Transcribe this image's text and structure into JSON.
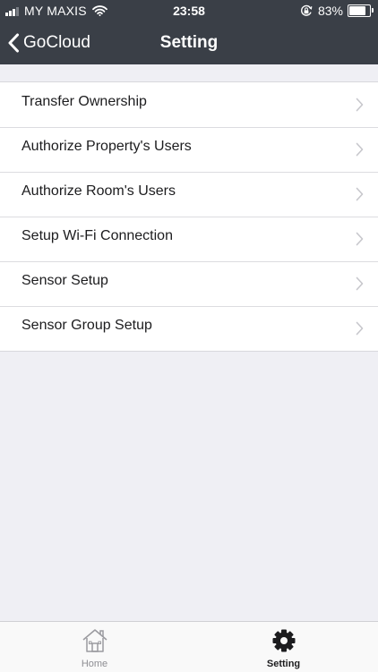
{
  "status_bar": {
    "carrier": "MY MAXIS",
    "time": "23:58",
    "battery_percent_label": "83%",
    "battery_level": 0.83,
    "icons": [
      "signal-icon",
      "wifi-icon",
      "orientation-lock-icon",
      "battery-icon"
    ]
  },
  "nav": {
    "back_label": "GoCloud",
    "title": "Setting",
    "back_icon": "chevron-left-icon"
  },
  "settings": {
    "items": [
      {
        "label": "Transfer Ownership"
      },
      {
        "label": "Authorize Property's Users"
      },
      {
        "label": "Authorize Room's Users"
      },
      {
        "label": "Setup Wi-Fi Connection"
      },
      {
        "label": "Sensor Setup"
      },
      {
        "label": "Sensor Group Setup"
      }
    ],
    "chevron_icon": "chevron-right-icon"
  },
  "tab_bar": {
    "tabs": [
      {
        "label": "Home",
        "icon": "home-icon",
        "selected": false
      },
      {
        "label": "Setting",
        "icon": "gear-icon",
        "selected": true
      }
    ]
  },
  "colors": {
    "header_background": "#3a3f47",
    "page_background": "#efeff4",
    "list_background": "#ffffff",
    "text_primary": "#1c1c1e",
    "tab_inactive": "#8e8e93",
    "chevron": "#c7c7cc"
  }
}
